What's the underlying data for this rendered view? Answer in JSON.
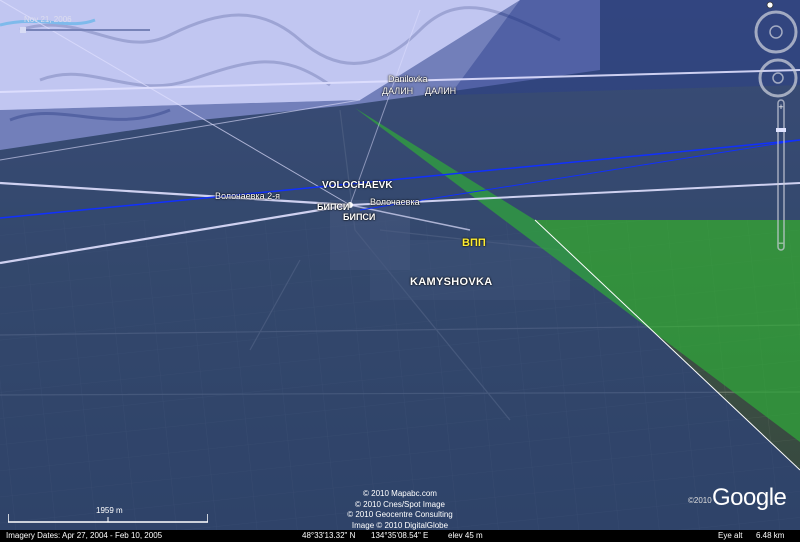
{
  "timeline": {
    "date": "Nov 21, 2006"
  },
  "places": {
    "danilovka": "Danilovka",
    "dalin_1": "ДАЛИН",
    "dalin_2": "ДАЛИН",
    "volochaevk": "VOLOCHAEVK",
    "volochaevka_2": "Волочаевка 2-я",
    "volochaevka": "Волочаевка",
    "bipsi_1": "БИПСИ",
    "bipsi_2": "БИПСИ",
    "vpp": "ВПП",
    "kamyshovka": "KAMYSHOVKA"
  },
  "scale": {
    "label": "1959 m"
  },
  "copyright": {
    "line1": "© 2010 Mapabc.com",
    "line2": "© 2010 Cnes/Spot Image",
    "line3": "© 2010 Geocentre Consulting",
    "line4": "Image © 2010 DigitalGlobe"
  },
  "logo": {
    "year": "©2010",
    "name": "Google"
  },
  "status": {
    "imagery": "Imagery Dates: Apr 27, 2004 - Feb 10, 2005",
    "lat": "48°33'13.32\" N",
    "lon": "134°35'08.54\" E",
    "elev": "elev   45 m",
    "eye_label": "Eye alt",
    "eye_value": "6.48 km"
  },
  "colors": {
    "blue_overlay": "#2a3f8c",
    "green_overlay": "#2fa83a",
    "light_overlay": "#b8bff0",
    "path_line": "#e0e0ff",
    "blue_line": "#1030ff"
  }
}
